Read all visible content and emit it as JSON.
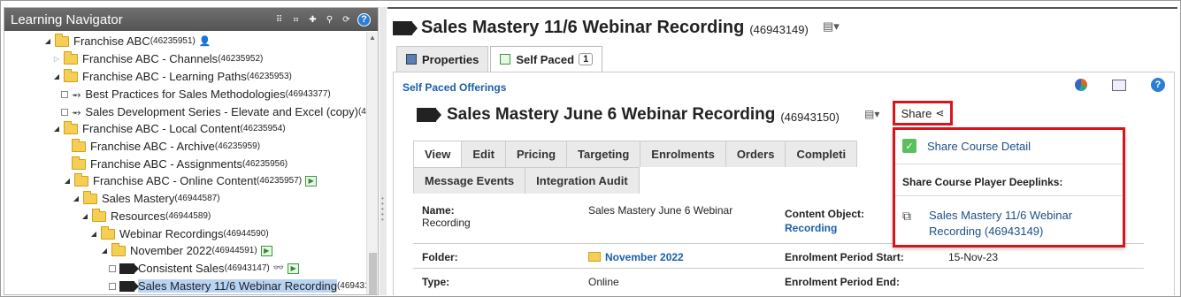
{
  "navigator": {
    "title": "Learning Navigator",
    "tree": [
      {
        "label": "Franchise ABC",
        "id": "(46235951)"
      },
      {
        "label": "Franchise ABC - Channels",
        "id": "(46235952)"
      },
      {
        "label": "Franchise ABC - Learning Paths",
        "id": "(46235953)"
      },
      {
        "label": "Best Practices for Sales Methodologies",
        "id": "(46943377)"
      },
      {
        "label": "Sales Development Series - Elevate and Excel (copy)",
        "id": "(4"
      },
      {
        "label": "Franchise ABC - Local Content",
        "id": "(46235954)"
      },
      {
        "label": "Franchise ABC - Archive",
        "id": "(46235959)"
      },
      {
        "label": "Franchise ABC - Assignments",
        "id": "(46235956)"
      },
      {
        "label": "Franchise ABC - Online Content",
        "id": "(46235957)"
      },
      {
        "label": "Sales Mastery",
        "id": "(46944587)"
      },
      {
        "label": "Resources",
        "id": "(46944589)"
      },
      {
        "label": "Webinar Recordings",
        "id": "(46944590)"
      },
      {
        "label": "November 2022",
        "id": "(46944591)"
      },
      {
        "label": "Consistent Sales",
        "id": "(46943147)"
      },
      {
        "label": "Sales Mastery 11/6 Webinar Recording",
        "id": "(469431"
      }
    ]
  },
  "header": {
    "title": "Sales Mastery 11/6 Webinar Recording",
    "id": "(46943149)"
  },
  "tabs": {
    "properties": "Properties",
    "self_paced": "Self Paced",
    "self_paced_count": "1"
  },
  "offering": {
    "section_label": "Self Paced Offerings",
    "title": "Sales Mastery June 6 Webinar Recording",
    "id": "(46943150)",
    "share_label": "Share"
  },
  "subtabs": {
    "row1": [
      "View",
      "Edit",
      "Pricing",
      "Targeting",
      "Enrolments",
      "Orders",
      "Completi"
    ],
    "row2": [
      "Message Events",
      "Integration Audit"
    ]
  },
  "details": {
    "name_label": "Name:",
    "name_value": "Sales Mastery June 6 Webinar",
    "name_value2": "Recording",
    "content_object_label": "Content Object:",
    "content_object_value": "Recording",
    "folder_label": "Folder:",
    "folder_value": "November 2022",
    "enrolment_start_label": "Enrolment Period Start:",
    "enrolment_start_value": "15-Nov-23",
    "type_label": "Type:",
    "type_value": "Online",
    "enrolment_end_label": "Enrolment Period End:"
  },
  "share_menu": {
    "share_course_detail": "Share Course Detail",
    "deeplinks_heading": "Share Course Player Deeplinks:",
    "deeplink_line1": "Sales Mastery 11/6 Webinar",
    "deeplink_line2": "Recording (46943149)"
  },
  "colors": {
    "accent_red": "#d9141c",
    "link_blue": "#1b5fa8",
    "header_gray": "#5f5f5f",
    "selection": "#b7d4f4"
  }
}
